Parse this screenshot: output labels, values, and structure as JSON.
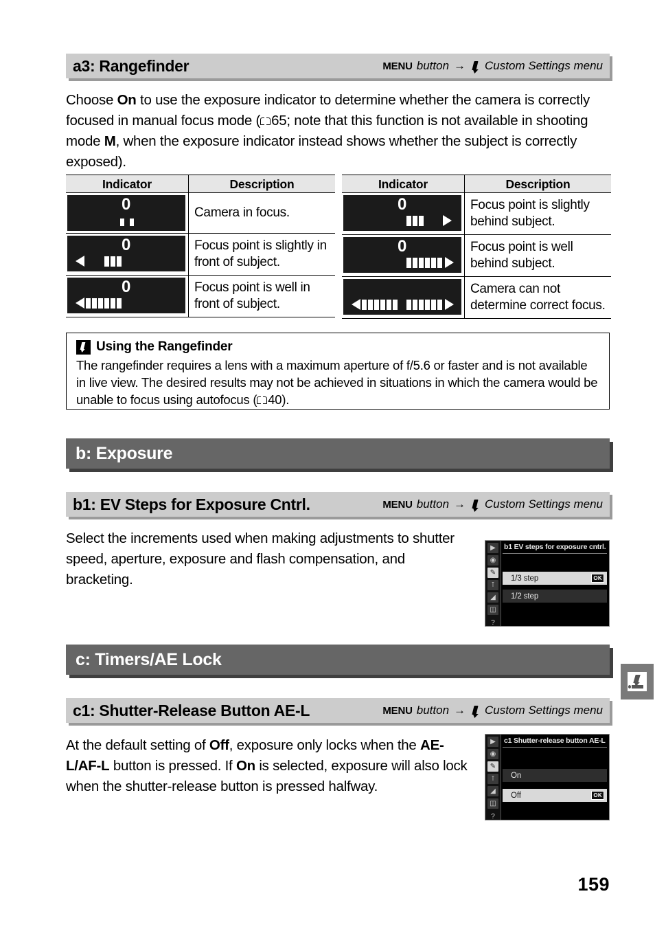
{
  "page": {
    "number": "159"
  },
  "sections": {
    "a3": {
      "title": "a3: Rangefinder",
      "path": {
        "menu_word": "MENU",
        "button_word": "button",
        "arrow": "→",
        "pencil_icon": "pencil-icon",
        "destination": "Custom Settings menu"
      },
      "body_lead": "Choose ",
      "body_bold_1": "On",
      "body_mid_1": " to use the exposure indicator to determine whether the camera is correctly focused in manual focus mode (",
      "body_ref_1": "65; note that this function is not available in shooting mode ",
      "body_bold_2": "M",
      "body_end": ", when the exposure indicator instead shows whether the subject is correctly exposed)."
    },
    "b_group": {
      "title": "b: Exposure"
    },
    "b1": {
      "title": "b1: EV Steps for Exposure Cntrl.",
      "path": {
        "menu_word": "MENU",
        "button_word": "button",
        "arrow": "→",
        "pencil_icon": "pencil-icon",
        "destination": "Custom Settings menu"
      },
      "body": "Select the increments used when making adjustments to shutter speed, aperture, exposure and flash compensation, and bracketing."
    },
    "c_group": {
      "title": "c: Timers/AE Lock"
    },
    "c1": {
      "title": "c1: Shutter-Release Button AE-L",
      "path": {
        "menu_word": "MENU",
        "button_word": "button",
        "arrow": "→",
        "pencil_icon": "pencil-icon",
        "destination": "Custom Settings menu"
      },
      "body_lead": "At the default setting of ",
      "body_bold_1": "Off",
      "body_mid_1": ", exposure only locks when the ",
      "body_bold_2": "AE-L/AF-L",
      "body_mid_2": " button is pressed.  If ",
      "body_bold_3": "On",
      "body_end": " is selected, exposure will also lock when the shutter-release button is pressed halfway."
    }
  },
  "indicator_table_left": {
    "headers": {
      "indicator": "Indicator",
      "description": "Description"
    },
    "rows": [
      {
        "description": "Camera in focus.",
        "zero": "0",
        "left_arrow": false,
        "right_arrow": false,
        "left_segments": 0,
        "right_segments": 0,
        "center_ticks": 2
      },
      {
        "description": "Focus point is slightly in front of subject.",
        "zero": "0",
        "left_arrow": true,
        "right_arrow": false,
        "left_segments": 3,
        "right_segments": 0,
        "center_ticks": 0
      },
      {
        "description": "Focus point is well in front of subject.",
        "zero": "0",
        "left_arrow": true,
        "right_arrow": false,
        "left_segments": 6,
        "right_segments": 0,
        "center_ticks": 0
      }
    ]
  },
  "indicator_table_right": {
    "headers": {
      "indicator": "Indicator",
      "description": "Description"
    },
    "rows": [
      {
        "description": "Focus point is slightly behind subject.",
        "zero": "0",
        "left_arrow": false,
        "right_arrow": true,
        "left_segments": 0,
        "right_segments": 3,
        "center_ticks": 0
      },
      {
        "description": "Focus point is well behind subject.",
        "zero": "0",
        "left_arrow": false,
        "right_arrow": true,
        "left_segments": 0,
        "right_segments": 6,
        "center_ticks": 0
      },
      {
        "description": "Camera can not determine correct focus.",
        "zero": "",
        "left_arrow": true,
        "right_arrow": true,
        "left_segments": 6,
        "right_segments": 6,
        "center_ticks": 0
      }
    ]
  },
  "screenshots": {
    "b1": {
      "title": "b1 EV steps for exposure cntrl.",
      "sidebar_icons": [
        "playback-icon",
        "camera-icon",
        "pencil-icon",
        "wrench-icon",
        "retouch-icon",
        "recent-settings-icon",
        "help-icon"
      ],
      "selected_sidebar_icon": "pencil-icon",
      "rows": [
        {
          "label": "1/3 step",
          "state": "highlighted",
          "ok_badge": "OK"
        },
        {
          "label": "1/2 step",
          "state": "dim",
          "ok_badge": ""
        }
      ]
    },
    "c1": {
      "title": "c1 Shutter-release button AE-L",
      "sidebar_icons": [
        "playback-icon",
        "camera-icon",
        "pencil-icon",
        "wrench-icon",
        "retouch-icon",
        "recent-settings-icon",
        "help-icon"
      ],
      "selected_sidebar_icon": "pencil-icon",
      "rows": [
        {
          "label": "On",
          "state": "dim",
          "ok_badge": ""
        },
        {
          "label": "Off",
          "state": "highlighted",
          "ok_badge": "OK"
        }
      ]
    }
  },
  "note": {
    "icon": "pencil-icon",
    "title": "Using the Rangefinder",
    "body_1": "The rangefinder requires a lens with a maximum aperture of f/5.6 or faster and is not available in live view.  The desired results may not be achieved in situations in which the camera would be unable to focus using autofocus (",
    "body_ref": "40)."
  },
  "side_tab": {
    "icon": "pencil-icon"
  }
}
